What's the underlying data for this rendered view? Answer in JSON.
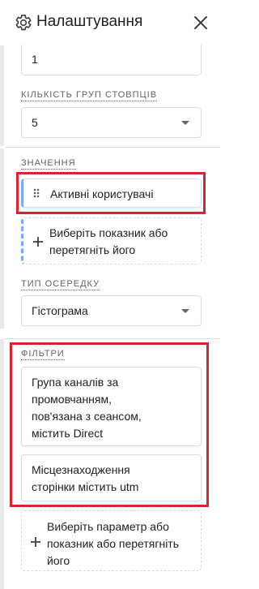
{
  "header": {
    "title": "Налаштування",
    "settings_icon": "gear-icon",
    "close_icon": "close-icon"
  },
  "top_input": {
    "value": "1"
  },
  "column_groups": {
    "label": "Кількість груп стовпців",
    "value": "5"
  },
  "values": {
    "label": "Значення",
    "chip_label": "Активні користувачі",
    "drop_text": [
      "Виберіть показник або",
      "перетягніть його"
    ]
  },
  "cell_type": {
    "label": "Тип осередку",
    "value": "Гістограма"
  },
  "filters": {
    "label": "Фільтри",
    "items": [
      {
        "lines": [
          "Група каналів за",
          "промовчанням,",
          "пов'язана з сеансом,",
          "містить Direct"
        ]
      },
      {
        "lines": [
          "Місцезнаходження",
          "сторінки містить utm"
        ]
      }
    ],
    "drop_text": [
      "Виберіть параметр або",
      "показник або перетягніть",
      "його"
    ]
  },
  "colors": {
    "accent_blue": "#7baaf7",
    "highlight_red": "#d9232e",
    "border": "#dadce0"
  }
}
